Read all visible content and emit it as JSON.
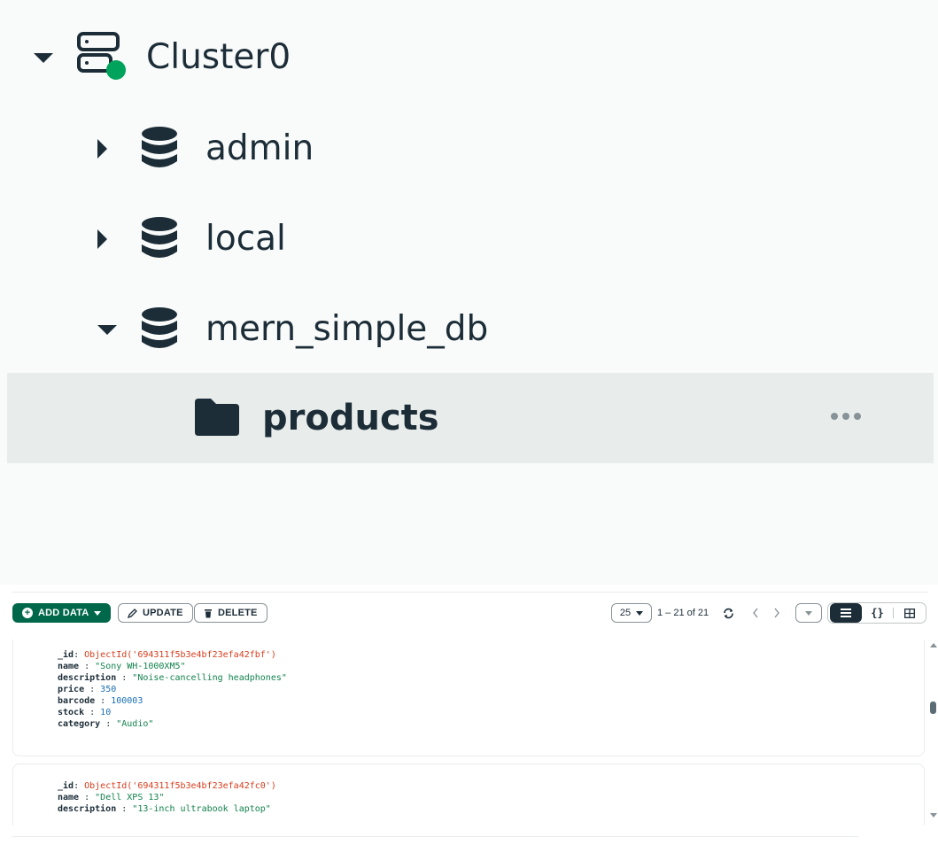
{
  "sidebar": {
    "cluster": {
      "label": "Cluster0",
      "status_color": "#00a35c"
    },
    "databases": [
      {
        "label": "admin",
        "expanded": false
      },
      {
        "label": "local",
        "expanded": false
      },
      {
        "label": "mern_simple_db",
        "expanded": true
      }
    ],
    "collection": {
      "label": "products",
      "selected": true
    }
  },
  "toolbar": {
    "add_data_label": "ADD DATA",
    "update_label": "UPDATE",
    "delete_label": "DELETE",
    "page_size": "25",
    "page_range": "1 – 21 of 21"
  },
  "documents": [
    {
      "fields": [
        {
          "key": "_id",
          "value": "ObjectId('694311f5b3e4bf23efa42fbf')",
          "type": "oid"
        },
        {
          "key": "name",
          "value": "\"Sony WH-1000XM5\"",
          "type": "str"
        },
        {
          "key": "description",
          "value": "\"Noise-cancelling headphones\"",
          "type": "str"
        },
        {
          "key": "price",
          "value": "350",
          "type": "num"
        },
        {
          "key": "barcode",
          "value": "100003",
          "type": "num"
        },
        {
          "key": "stock",
          "value": "10",
          "type": "num"
        },
        {
          "key": "category",
          "value": "\"Audio\"",
          "type": "str"
        }
      ]
    },
    {
      "fields": [
        {
          "key": "_id",
          "value": "ObjectId('694311f5b3e4bf23efa42fc0')",
          "type": "oid"
        },
        {
          "key": "name",
          "value": "\"Dell XPS 13\"",
          "type": "str"
        },
        {
          "key": "description",
          "value": "\"13-inch ultrabook laptop\"",
          "type": "str"
        }
      ]
    }
  ],
  "colors": {
    "brand_green": "#00684a",
    "text_dark": "#1c2d38",
    "objectid": "#d83c1c",
    "string": "#12824d",
    "number": "#1a6fb3"
  },
  "icons": [
    "server-icon",
    "database-icon",
    "folder-icon",
    "ellipsis-icon",
    "plus-circle-icon",
    "pencil-icon",
    "trash-icon",
    "refresh-icon",
    "chevron-left-icon",
    "chevron-right-icon",
    "list-view-icon",
    "json-view-icon",
    "table-view-icon"
  ]
}
